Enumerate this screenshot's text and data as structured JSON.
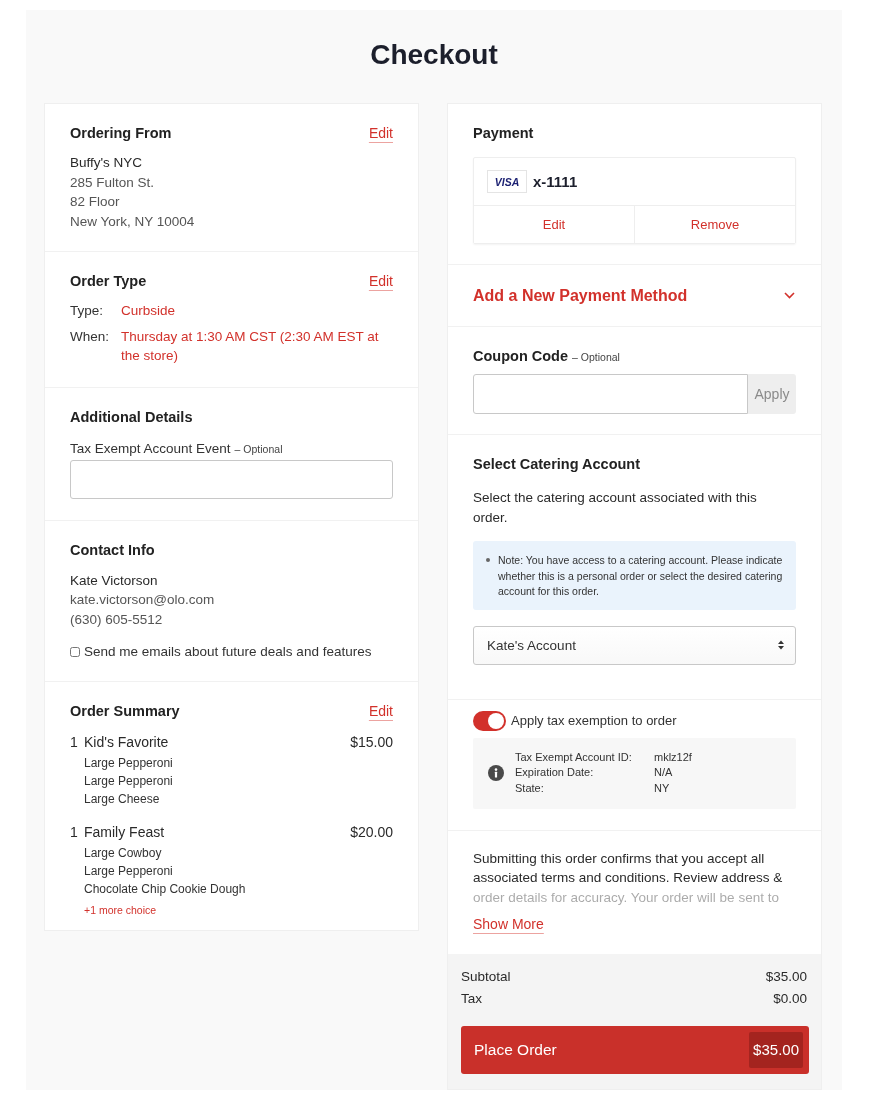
{
  "page": {
    "title": "Checkout"
  },
  "ordering_from": {
    "heading": "Ordering From",
    "edit": "Edit",
    "name": "Buffy's NYC",
    "address_lines": [
      "285 Fulton St.",
      "82 Floor",
      "New York, NY 10004"
    ]
  },
  "order_type": {
    "heading": "Order Type",
    "edit": "Edit",
    "rows": [
      {
        "label": "Type:",
        "value": "Curbside"
      },
      {
        "label": "When:",
        "value": "Thursday at 1:30 AM CST (2:30 AM EST at the store)"
      }
    ]
  },
  "additional_details": {
    "heading": "Additional Details",
    "field": {
      "label": "Tax Exempt Account Event",
      "hint": "– Optional"
    }
  },
  "contact_info": {
    "heading": "Contact Info",
    "name": "Kate Victorson",
    "lines": [
      "kate.victorson@olo.com",
      "(630) 605-5512"
    ],
    "newsletter": {
      "label": "Send me emails about future deals and features",
      "checked": false
    }
  },
  "order_summary": {
    "heading": "Order Summary",
    "edit": "Edit",
    "items": [
      {
        "quantity": "1",
        "name": "Kid's Favorite",
        "price": "$15.00",
        "choices": [
          "Large Pepperoni",
          "Large Pepperoni",
          "Large Cheese"
        ]
      },
      {
        "quantity": "1",
        "name": "Family Feast",
        "price": "$20.00",
        "choices": [
          "Large Cowboy",
          "Large Pepperoni",
          "Chocolate Chip Cookie Dough"
        ],
        "more_choices": "+1 more choice"
      }
    ]
  },
  "payment": {
    "heading": "Payment",
    "card": {
      "brand": "VISA",
      "number": "x-1111"
    },
    "actions": [
      {
        "label": "Edit"
      },
      {
        "label": "Remove"
      }
    ]
  },
  "add_payment": {
    "label": "Add a New Payment Method",
    "expanded": false
  },
  "coupon": {
    "heading": "Coupon Code",
    "hint": "– Optional",
    "apply_button": {
      "label": "Apply",
      "disabled": true
    }
  },
  "catering": {
    "heading": "Select Catering Account",
    "description": "Select the catering account associated with this order.",
    "note": "Note: You have access to a catering account. Please indicate whether this is a personal order or select the desired catering account for this order.",
    "account": {
      "value": "Kate's Account"
    }
  },
  "tax_exemption": {
    "label": "Apply tax exemption to order",
    "on": true,
    "details": [
      {
        "label": "Tax Exempt Account ID:",
        "value": "mklz12f"
      },
      {
        "label": "Expiration Date:",
        "value": "N/A"
      },
      {
        "label": "State:",
        "value": "NY"
      }
    ]
  },
  "terms": {
    "text": "Submitting this order confirms that you accept all associated terms and conditions. Review address & order details for accuracy. Your order will be sent to",
    "link": "Show More"
  },
  "totals": {
    "rows": [
      {
        "label": "Subtotal",
        "value": "$35.00"
      },
      {
        "label": "Tax",
        "value": "$0.00"
      }
    ],
    "button": {
      "label": "Place Order",
      "amount": "$35.00"
    }
  }
}
